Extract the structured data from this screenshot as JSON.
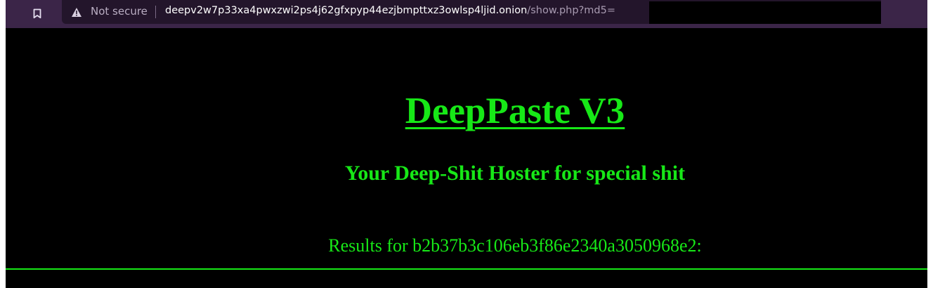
{
  "browser": {
    "security_label": "Not secure",
    "url_host": "deepv2w7p33xa4pwxzwi2ps4j62gfxpyp44ezjbmpttxz3owlsp4ljid.onion",
    "url_path": "/show.php?md5=",
    "icons": {
      "bookmark": "bookmark-icon",
      "warning": "warning-icon"
    }
  },
  "page": {
    "title": "DeepPaste V3",
    "tagline": "Your Deep-Shit Hoster for special shit",
    "results_prefix": "Results for b2b37b3c106eb3f86e2340a3050968e2:"
  },
  "colors": {
    "accent": "#17e817",
    "background": "#000000",
    "toolbar": "#3b2548",
    "omnibox": "#23152b"
  }
}
